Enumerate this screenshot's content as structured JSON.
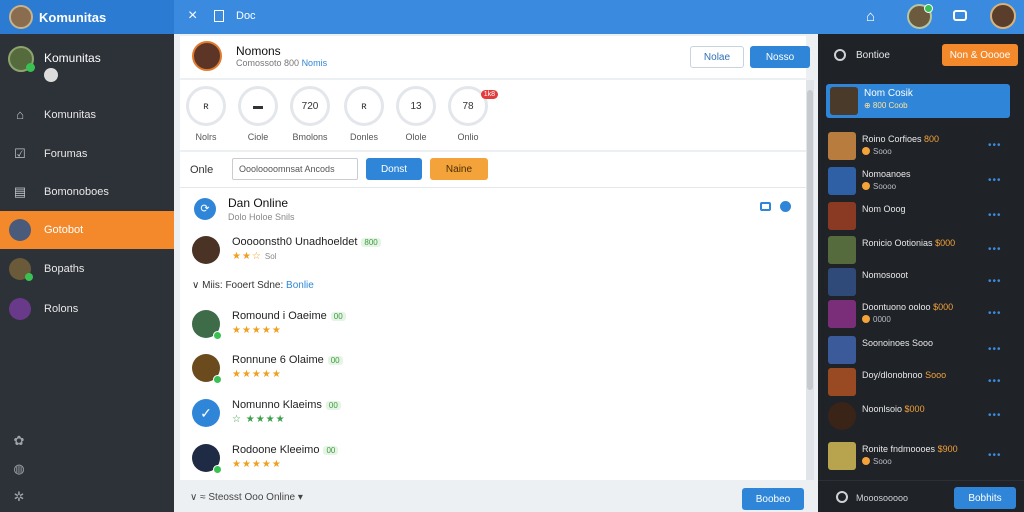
{
  "app": {
    "title": "Komunitas"
  },
  "topbar": {
    "close_icon": "×",
    "label": "Doc"
  },
  "sidebar": {
    "profile_name": "Komunitas",
    "items": [
      {
        "label": "Komunitas",
        "icon": "home-icon"
      },
      {
        "label": "Forumas",
        "icon": "checkbox-icon"
      },
      {
        "label": "Bomonoboes",
        "icon": "document-icon"
      },
      {
        "label": "Gotobot",
        "icon": "avatar",
        "active": true
      },
      {
        "label": "Bopaths",
        "icon": "avatar"
      },
      {
        "label": "Rolons",
        "icon": "avatar"
      }
    ]
  },
  "profile": {
    "name": "Nomons",
    "sub_text": "Comossoto 800",
    "sub_link": "Nomis",
    "button_outline": "Nolae",
    "button_primary": "Nosso"
  },
  "stats": [
    {
      "value": "ʀ",
      "label": "Nolrs"
    },
    {
      "value": "▬",
      "label": "Ciole"
    },
    {
      "value": "720",
      "label": "Bmolons"
    },
    {
      "value": "ʀ",
      "label": "Donles"
    },
    {
      "value": "13",
      "label": "Olole"
    },
    {
      "value": "78",
      "label": "Onlio",
      "badge": "1k8"
    }
  ],
  "chat": {
    "toolbar_label": "Onle",
    "search_placeholder": "Oooloooomnsat Ancods",
    "send_label": "Donst",
    "more_label": "Naine",
    "online_title": "Dan Online",
    "online_sub": "Dolo  Holoe Snils",
    "section_label": "Miis: Fooert Sdne:",
    "section_link": "Bonlie",
    "messages": [
      {
        "name": "Ooooonsth0 Unadhoeldet",
        "tag": "800",
        "stars": "★★☆",
        "sub": "Sol",
        "color": "#4a3324"
      },
      {
        "name": "Romound i Oaeime",
        "tag": "00",
        "stars": "★★★★★",
        "sub": "",
        "color": "#3e6b48"
      },
      {
        "name": "Ronnune 6 Olaime",
        "tag": "00",
        "stars": "★★★★★",
        "sub": "",
        "color": "#6b4a1e"
      },
      {
        "name": "Nomunno Klaeims",
        "tag": "00",
        "stars": "☆ ★★★★",
        "sub": "",
        "color": "#2f86d8"
      },
      {
        "name": "Rodoone Kleeimo",
        "tag": "00",
        "stars": "★★★★★",
        "sub": "",
        "color": "#1f2a44"
      }
    ],
    "footer_text": "∨  ≈  Steosst Ooo Online ▾",
    "footer_button": "Boobeo"
  },
  "rpanel": {
    "title": "Bontioe",
    "top_button": "Non & Ooooe",
    "featured": {
      "name": "Nom Cosik",
      "sub": "⊕ 800 Coob"
    },
    "items": [
      {
        "name": "Roino Corfioes",
        "hl": "800",
        "sub": "Sooo",
        "color": "#b87d3e"
      },
      {
        "name": "Nomoanoes",
        "hl": "",
        "sub": "Soooo",
        "color": "#2f5fa5"
      },
      {
        "name": "Nom Ooog",
        "hl": "",
        "sub": "",
        "color": "#8a3a22"
      },
      {
        "name": "Ronicio Ootionias",
        "hl": "$000",
        "sub": "",
        "color": "#556b3e"
      },
      {
        "name": "Nomosooot",
        "hl": "",
        "sub": "",
        "color": "#2f4a78"
      },
      {
        "name": "Doontuono ooloo",
        "hl": "$000",
        "sub": "0000",
        "color": "#7a2e7a"
      },
      {
        "name": "Soonoinoes Sooo",
        "hl": "",
        "sub": "",
        "color": "#3a5a9a"
      },
      {
        "name": "Doy/dlonobnoo",
        "hl": "Sooo",
        "sub": "",
        "color": "#9a4a22"
      },
      {
        "name": "Noonlsoio",
        "hl": "$000",
        "sub": "",
        "color": "#3a2418"
      },
      {
        "name": "Ronite fndmoooes",
        "hl": "$900",
        "sub": "Sooo",
        "color": "#b8a44e"
      }
    ],
    "footer_text": "Mooosooooo",
    "footer_button": "Bobhits"
  }
}
